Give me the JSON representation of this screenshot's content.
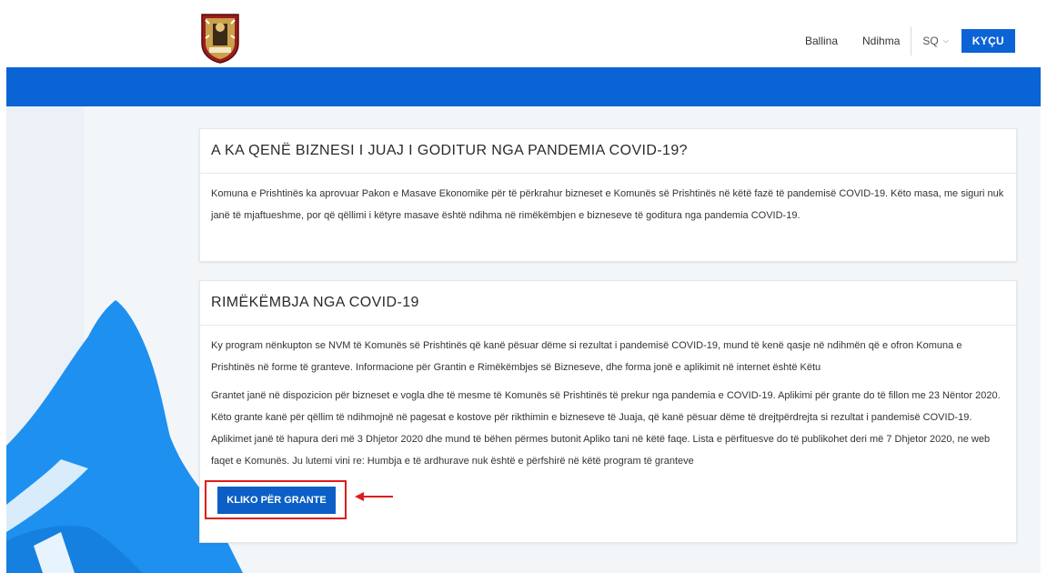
{
  "header": {
    "nav_home": "Ballina",
    "nav_help": "Ndihma",
    "language": "SQ",
    "login": "KYÇU"
  },
  "cards": [
    {
      "title": "A KA QENË BIZNESI I JUAJ I GODITUR NGA PANDEMIA COVID-19?",
      "paragraphs": [
        "Komuna e Prishtinës ka aprovuar Pakon e Masave Ekonomike për të përkrahur bizneset e Komunës së Prishtinës në këtë fazë të pandemisë COVID-19. Këto masa, me siguri nuk janë të mjaftueshme, por që qëllimi i këtyre masave është ndihma në rimëkëmbjen e bizneseve të goditura nga pandemia COVID-19."
      ]
    },
    {
      "title": "RIMËKËMBJA NGA COVID-19",
      "paragraphs": [
        "Ky program nënkupton se NVM të Komunës së Prishtinës që kanë pësuar dëme si rezultat i pandemisë COVID-19, mund të kenë qasje në ndihmën që e ofron Komuna e Prishtinës në forme të granteve. Informacione për Grantin e Rimëkëmbjes së Bizneseve, dhe forma jonë e aplikimit në internet është Këtu",
        "Grantet janë në dispozicion për bizneset e vogla dhe të mesme të Komunës së Prishtinës të prekur nga pandemia e COVID-19. Aplikimi për grante do të fillon me 23 Nëntor 2020. Këto grante kanë për qëllim të ndihmojnë në pagesat e kostove për rikthimin e bizneseve të Juaja, që kanë pësuar dëme të drejtpërdrejta si rezultat i pandemisë COVID-19. Aplikimet janë të hapura deri më 3 Dhjetor 2020 dhe mund të bëhen përmes butonit Apliko tani në këtë faqe. Lista e përfituesve do të publikohet deri më 7 Dhjetor 2020, ne web faqet e Komunës. Ju lutemi vini re: Humbja e të ardhurave nuk është e përfshirë në këtë program të granteve"
      ],
      "button": "KLIKO PËR GRANTE"
    }
  ],
  "colors": {
    "brand_blue": "#0a64d5",
    "highlight_red": "#e01b1b"
  }
}
